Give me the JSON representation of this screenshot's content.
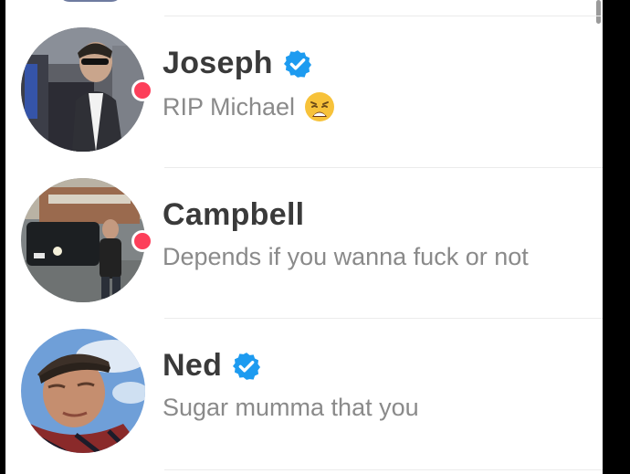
{
  "conversations": [
    {
      "name": "Joseph",
      "verified": true,
      "unread": true,
      "last_message": "RIP Michael",
      "emoji": "weary-face-emoji"
    },
    {
      "name": "Campbell",
      "verified": false,
      "unread": true,
      "last_message": "Depends if you wanna fuck or not",
      "emoji": ""
    },
    {
      "name": "Ned",
      "verified": true,
      "unread": false,
      "last_message": "Sugar mumma that you",
      "emoji": ""
    }
  ],
  "colors": {
    "unread_dot": "#fd3f5a",
    "verified_badge": "#1d9bf0",
    "name_text": "#3a3a3a",
    "message_text": "#8a8a8a"
  }
}
